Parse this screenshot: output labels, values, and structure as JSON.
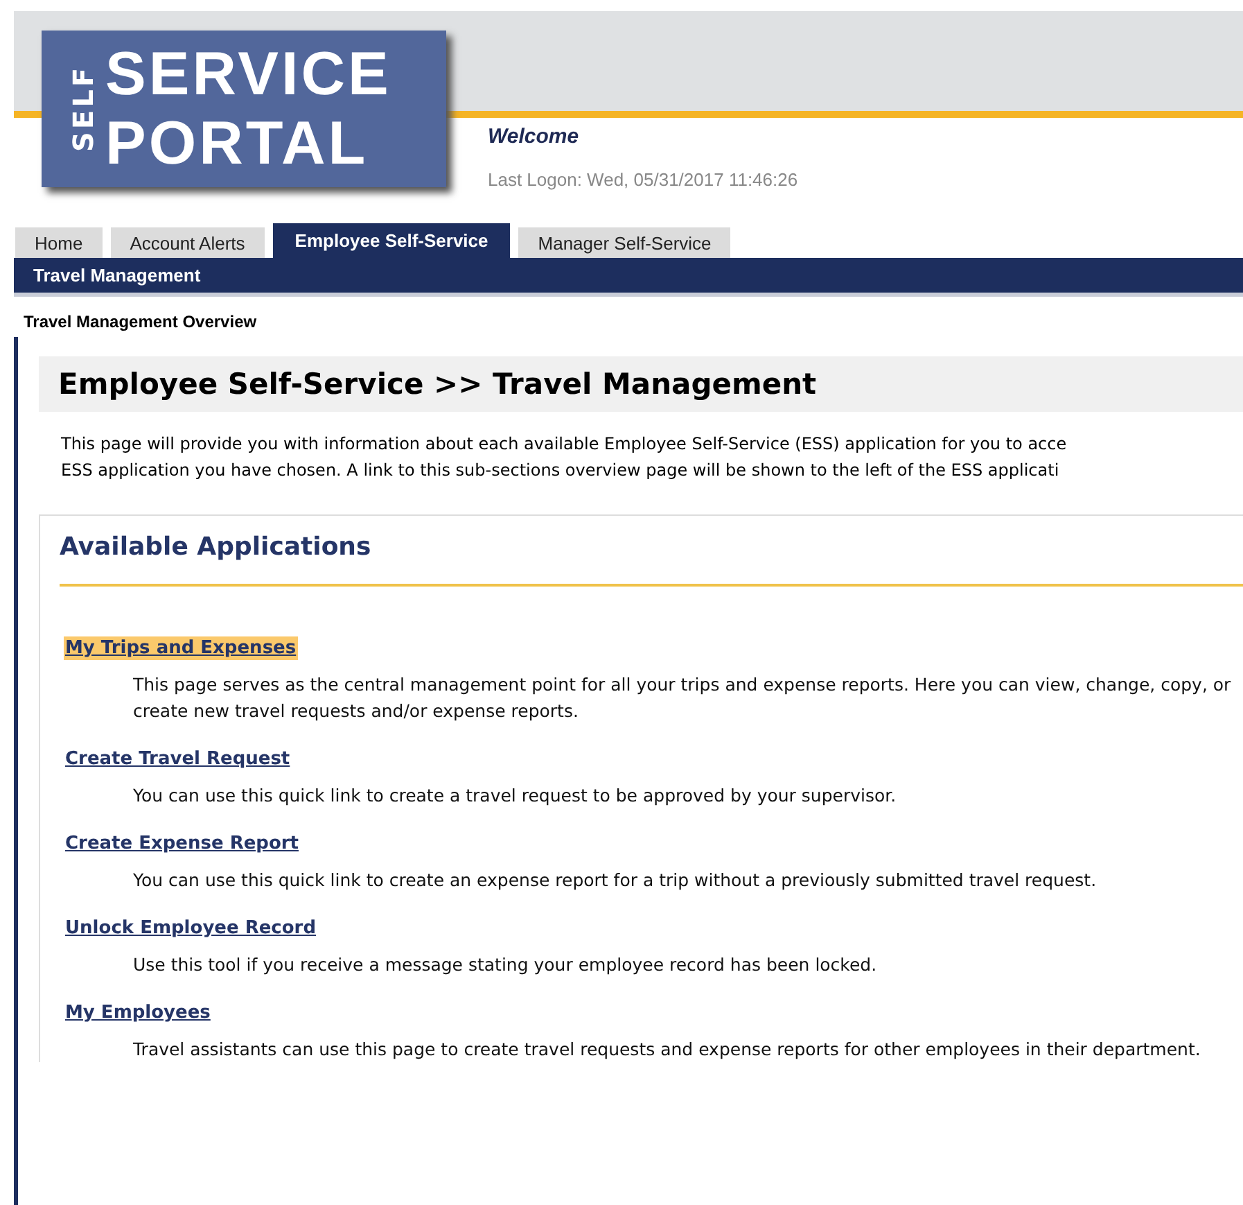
{
  "logo": {
    "side": "SELF",
    "line_1": "SERVICE",
    "line_2": "PORTAL"
  },
  "welcome": "Welcome",
  "last_logon": "Last Logon: Wed, 05/31/2017 11:46:26",
  "tabs": [
    {
      "label": "Home",
      "selected": false
    },
    {
      "label": "Account Alerts",
      "selected": false
    },
    {
      "label": "Employee Self-Service",
      "selected": true
    },
    {
      "label": "Manager Self-Service",
      "selected": false
    }
  ],
  "subnav": [
    {
      "label": "Travel Management",
      "selected": true
    }
  ],
  "breadcrumb": "Travel Management Overview",
  "page_title": "Employee Self-Service >> Travel Management",
  "intro": [
    "This page will provide you with information about each available Employee Self-Service (ESS) application for you to acce",
    "ESS application you have chosen. A link to this sub-sections overview page will be shown to the left of the ESS applicati"
  ],
  "section_title": "Available Applications",
  "applications": [
    {
      "link": "My Trips and Expenses",
      "highlighted": true,
      "description": "This page serves as the central management point for all your trips and expense reports. Here you can view, change, copy, or create new travel requests and/or expense reports."
    },
    {
      "link": "Create Travel Request",
      "highlighted": false,
      "description": "You can use this quick link to create a travel request to be approved by your supervisor."
    },
    {
      "link": "Create Expense Report",
      "highlighted": false,
      "description": "You can use this quick link to create an expense report for a trip without a previously submitted travel request."
    },
    {
      "link": "Unlock Employee Record",
      "highlighted": false,
      "description": "Use this tool if you receive a message stating your employee record has been locked."
    },
    {
      "link": "My Employees",
      "highlighted": false,
      "description": "Travel assistants can use this page to create travel requests and expense reports for other employees in their department."
    }
  ]
}
